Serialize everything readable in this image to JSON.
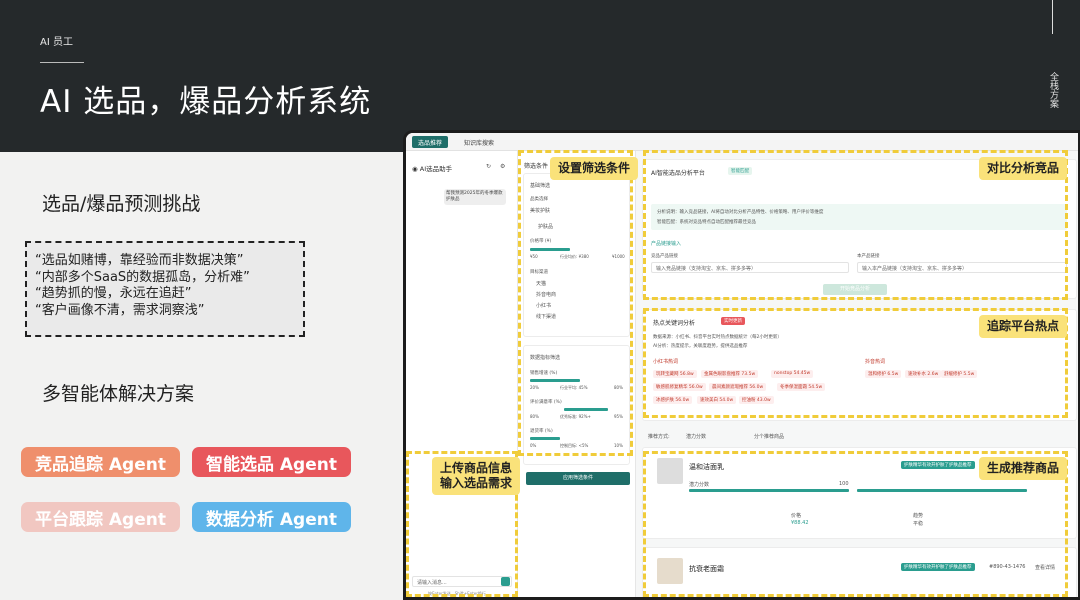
{
  "header": {
    "tag": "AI 员工",
    "title": "AI 选品，爆品分析系统",
    "side_label": "全栈方案"
  },
  "left": {
    "challenge_title": "选品/爆品预测挑战",
    "quotes": [
      "“选品如赌博，靠经验而非数据决策”",
      "“内部多个SaaS的数据孤岛，分析难”",
      "“趋势抓的慢，永远在追赶”",
      "“客户画像不清，需求洞察浅”"
    ],
    "solution_title": "多智能体解决方案",
    "agents": [
      {
        "label": "竞品追踪 Agent",
        "color": "#ef8f6c"
      },
      {
        "label": "智能选品 Agent",
        "color": "#e8575c"
      },
      {
        "label": "平台跟踪 Agent",
        "color": "#f1c7c1"
      },
      {
        "label": "数据分析 Agent",
        "color": "#5fb5ea"
      }
    ]
  },
  "app": {
    "tabs": [
      "选品推荐",
      "知识库搜索"
    ],
    "chat": {
      "title": "AI选品助手",
      "bubble": "帮我预测2025年的冬季爆款护肤品",
      "input_placeholder": "请输入消息...",
      "hint": "按Enter发送，Shift+Enter换行"
    },
    "filter": {
      "title": "筛选条件",
      "basic": "基础筛选",
      "category_label": "品类选择",
      "category_value": "美妆护肤",
      "sub_value": "护肤品",
      "price_label": "价格带 (¥)",
      "price_min": "¥50",
      "price_mid": "行业均价: ¥380",
      "price_max": "¥1000",
      "platform_label": "目标渠道",
      "platforms": [
        "天猫",
        "抖音电商",
        "小红书",
        "线下渠道"
      ],
      "metric_title": "数据指标筛选",
      "m1": "销售增速 (%)",
      "m1_ticks": [
        "20%",
        "行业平均: 45%",
        "80%"
      ],
      "m2": "评价满意率 (%)",
      "m2_ticks": [
        "80%",
        "优秀标准: 92%+",
        "95%"
      ],
      "m3": "退货率 (%)",
      "m3_ticks": [
        "0%",
        "控制目标: <5%",
        "10%"
      ],
      "apply": "应用筛选条件"
    },
    "compare": {
      "title": "AI智能选品分析平台",
      "badge": "智能匹配",
      "desc1": "分析说明：输入竞品链接，AI将自动对比分析产品特性、价格策略、用户评价等维度",
      "desc2": "智能匹配：系统对竞品特点自动匹配推荐最佳竞品",
      "link_title": "产品链接输入",
      "comp_label": "竞品产品链接",
      "comp_placeholder": "输入竞品链接（支持淘宝、京东、拼多多等）",
      "own_label": "本产品链接",
      "own_placeholder": "输入本产品链接（支持淘宝、京东、拼多多等）",
      "start": "开始竞品分析"
    },
    "hot": {
      "title": "热点关键词分析",
      "badge": "实时更新",
      "src": "数据来源：小红书、抖音平台实时热点数据统计（每2小时更新）",
      "ai": "AI分析：热度提示，关联度趋势，提供选品推荐",
      "red_title": "小红书热词",
      "douyin_title": "抖音热词",
      "red_tags": [
        "玩转宝藏网 56.8w",
        "金属色眼影盘推荐 73.5w",
        "nonstop 54.45w",
        "敏感肌修复精华 56.0w",
        "晨间素颜遮瑕推荐 56.0w",
        "冬季保湿面霜 54.5w",
        "冰感护肤 56.0w",
        "速效美白 54.0w",
        "控油粉 43.0w"
      ],
      "douyin_tags": [
        "温和修护 6.5w",
        "速效补水 2.6w",
        "舒缓修护 5.5w"
      ]
    },
    "sort": {
      "label": "推荐方式:",
      "value": "潜力分数",
      "view": "分个推荐商品"
    },
    "products": [
      {
        "name": "温和洁面乳",
        "tag": "护肤精华有效开护肤了护肤品推荐",
        "score_label": "潜力分数",
        "score": "100",
        "price_label": "价格",
        "price": "¥88.42",
        "trend_label": "趋势",
        "trend": "平稳"
      },
      {
        "name": "抗衰老面霜",
        "tag": "护肤精华有效开护肤了护肤品推荐",
        "code": "#890-43-1476",
        "view": "查看详情"
      }
    ]
  },
  "annotations": [
    "设置筛选条件",
    "对比分析竞品",
    "追踪平台热点",
    "上传商品信息\n输入选品需求",
    "生成推荐商品"
  ]
}
